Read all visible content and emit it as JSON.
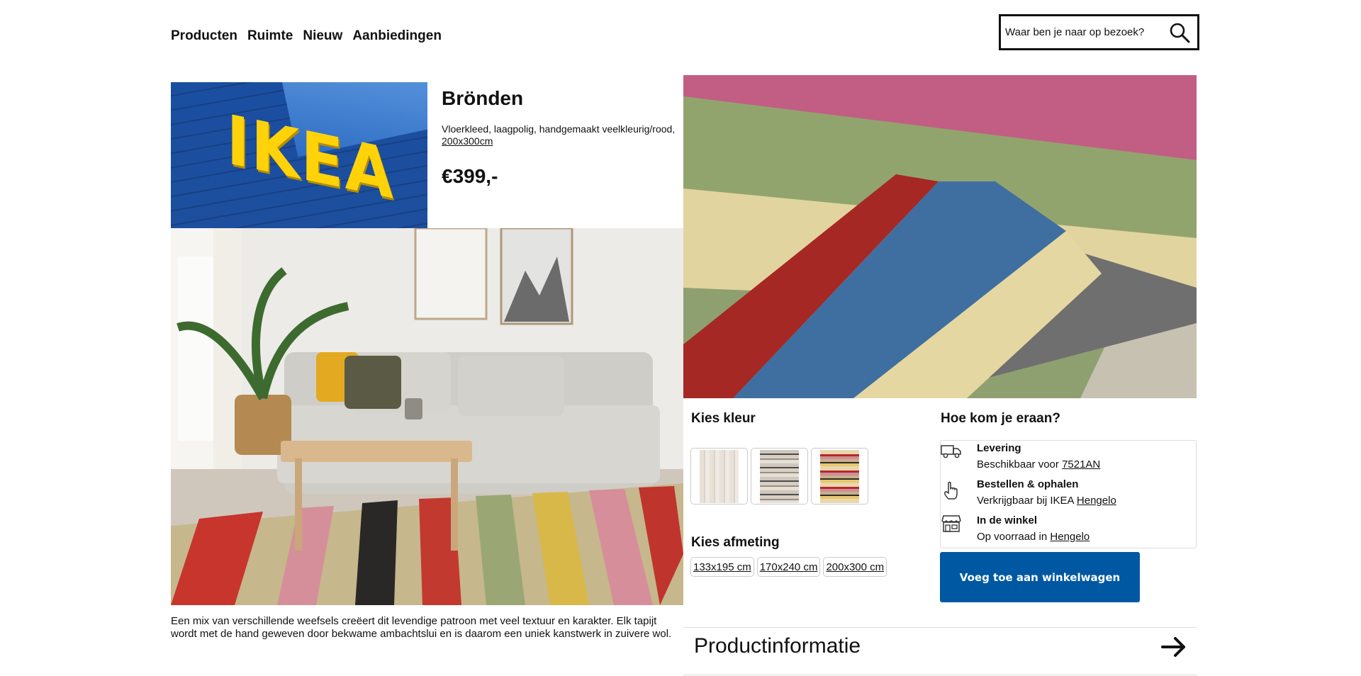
{
  "nav": {
    "items": [
      "Producten",
      "Ruimte",
      "Nieuw",
      "Aanbiedingen"
    ]
  },
  "search": {
    "placeholder": "Waar ben je naar op bezoek?",
    "icon": "search-icon"
  },
  "logo": {
    "text": "IKEA"
  },
  "product": {
    "name": "Brönden",
    "description": "Vloerkleed, laagpolig, handgemaakt veelkleurig/rood,",
    "size": "200x300cm",
    "price": "€399,-",
    "long_description": "Een mix van verschillende weefsels creëert dit levendige patroon met veel textuur en karakter. Elk tapijt wordt met de hand geweven door bekwame ambachtslui en is daarom een uniek kanstwerk in zuivere wol."
  },
  "options": {
    "color_heading": "Kies kleur",
    "size_heading": "Kies afmeting",
    "sizes": [
      "133x195 cm",
      "170x240 cm",
      "200x300 cm"
    ]
  },
  "delivery": {
    "heading": "Hoe kom je eraan?",
    "items": [
      {
        "icon": "truck-icon",
        "title": "Levering",
        "text": "Beschikbaar voor ",
        "link": "7521AN"
      },
      {
        "icon": "hand-pointer-icon",
        "title": "Bestellen & ophalen",
        "text": "Verkrijgbaar bij IKEA ",
        "link": "Hengelo"
      },
      {
        "icon": "store-icon",
        "title": "In de winkel",
        "text": "Op voorraad in ",
        "link": "Hengelo"
      }
    ]
  },
  "cart": {
    "label": "Voeg toe aan winkelwagen",
    "color": "#0058a3"
  },
  "product_info": {
    "title": "Productinformatie",
    "icon": "arrow-right-icon"
  }
}
